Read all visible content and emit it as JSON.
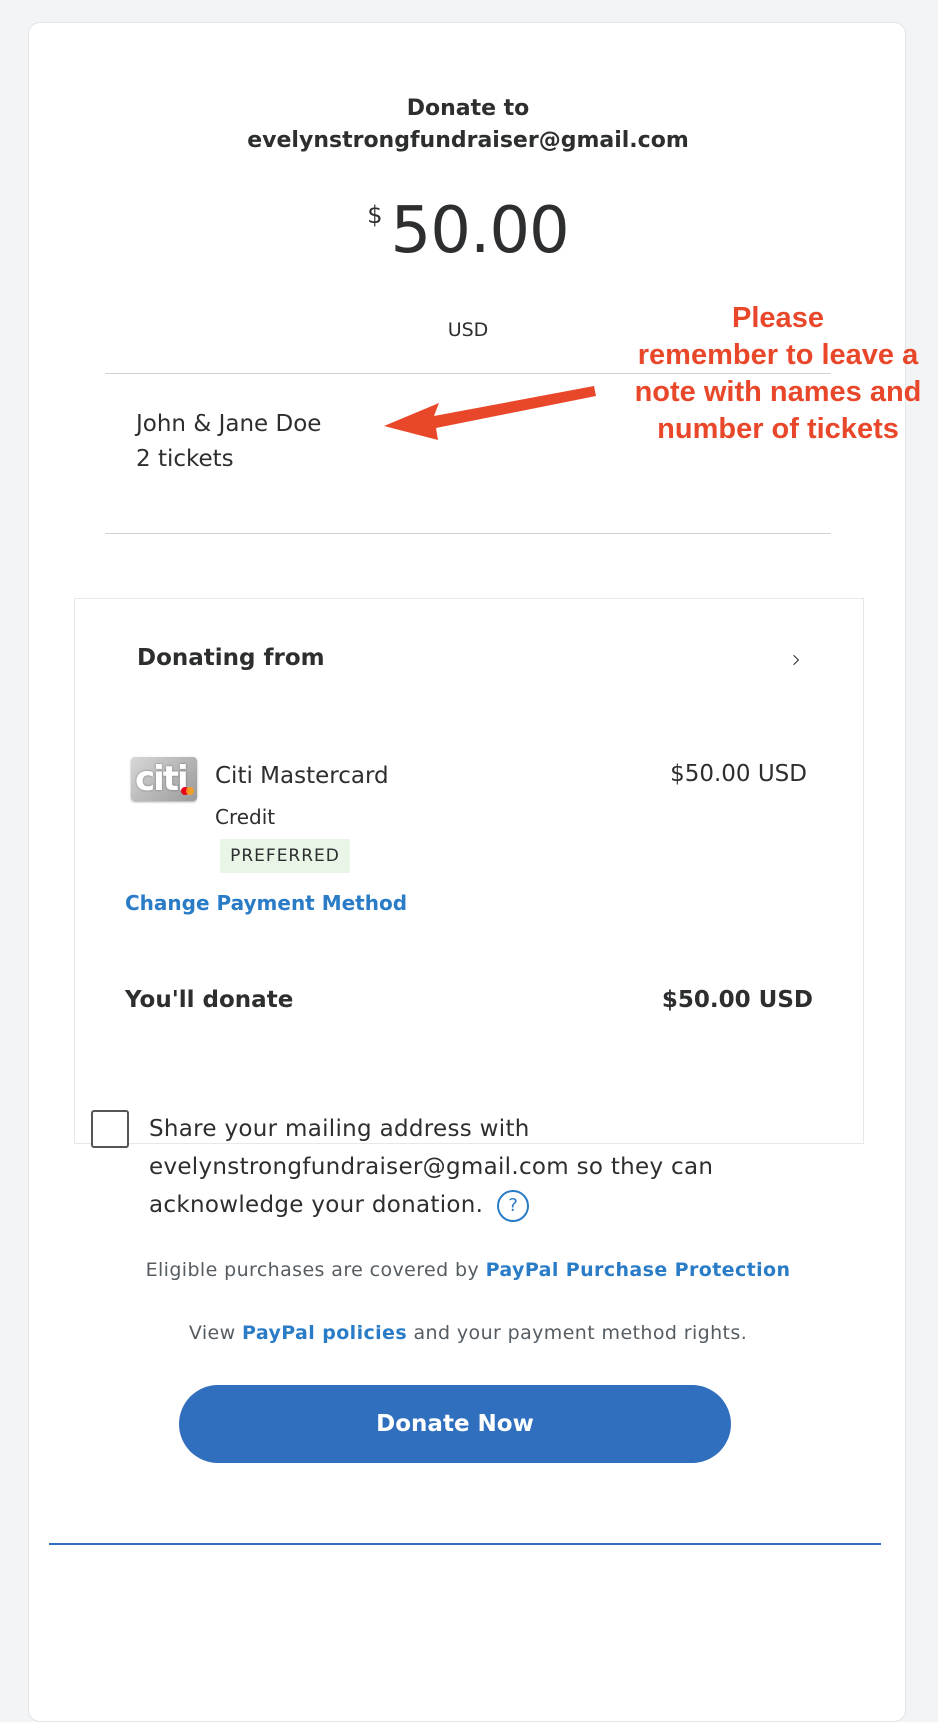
{
  "header": {
    "donate_to_label": "Donate to",
    "recipient_email": "evelynstrongfundraiser@gmail.com"
  },
  "amount": {
    "currency_symbol": "$",
    "value": "50.00",
    "currency_code": "USD"
  },
  "note": {
    "line1": "John & Jane Doe",
    "line2": "2 tickets"
  },
  "annotation": {
    "line1": "Please",
    "line2": "remember to leave a",
    "line3": "note with names and",
    "line4": "number of tickets",
    "color": "#e9472a"
  },
  "payment": {
    "section_title": "Donating from",
    "card_name": "Citi Mastercard",
    "card_type": "Credit",
    "badge": "PREFERRED",
    "card_amount": "$50.00 USD",
    "change_link": "Change Payment Method",
    "total_label": "You'll donate",
    "total_value": "$50.00 USD",
    "logo_text": "citi"
  },
  "share": {
    "line1": "Share your mailing address with",
    "line2": "evelynstrongfundraiser@gmail.com so they can",
    "line3": "acknowledge your donation.",
    "help_glyph": "?",
    "checked": false
  },
  "legal": {
    "protection_prefix": "Eligible purchases are covered by",
    "protection_link": "PayPal Purchase Protection",
    "policy_prefix": "View",
    "policy_link": "PayPal policies",
    "policy_suffix": "and your payment method rights."
  },
  "actions": {
    "donate_button": "Donate Now"
  },
  "colors": {
    "link": "#2a7cc7",
    "button": "#2f6fbd",
    "badge_bg": "#e8f5e7"
  }
}
